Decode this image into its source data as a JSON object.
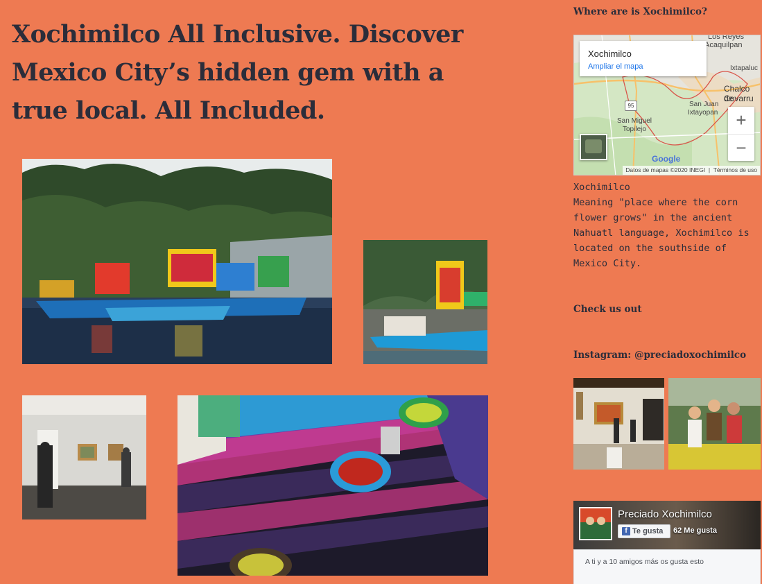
{
  "page": {
    "title": "Xochimilco All Inclusive. Discover Mexico City’s hidden gem with a true local. All Included."
  },
  "gallery": {
    "images": [
      "trajineras-boats-photo",
      "trajinera-close-photo",
      "museum-gallery-photo",
      "textile-salsa-photo"
    ]
  },
  "sidebar": {
    "where_heading": "Where are is Xochimilco?",
    "map": {
      "place_name": "Xochimilco",
      "enlarge_link": "Ampliar el mapa",
      "labels": [
        "Los Reyes",
        "Acaquilpan",
        "Ixtapaluc",
        "Chalco de",
        "Covarru",
        "San Juan",
        "Ixtayopan",
        "San Miguel",
        "Topilejo",
        "95",
        "Google"
      ],
      "zoom_in": "+",
      "zoom_out": "−",
      "attribution": "Datos de mapas ©2020 INEGI",
      "terms": "Términos de uso"
    },
    "description": "Xochimilco\nMeaning \"place where the corn flower grows\" in the ancient Nahuatl language, Xochimilco is located on the southside of Mexico City.",
    "check_heading": "Check us out",
    "instagram_heading": "Instagram: @preciadoxochimilco",
    "facebook": {
      "page_name": "Preciado Xochimilco",
      "like_button": "Te gusta",
      "like_count": "62 Me gusta",
      "friends_text": "A ti y a 10 amigos más os gusta esto"
    }
  },
  "colors": {
    "background": "#ee7a52",
    "heading": "#2b2d3a"
  }
}
